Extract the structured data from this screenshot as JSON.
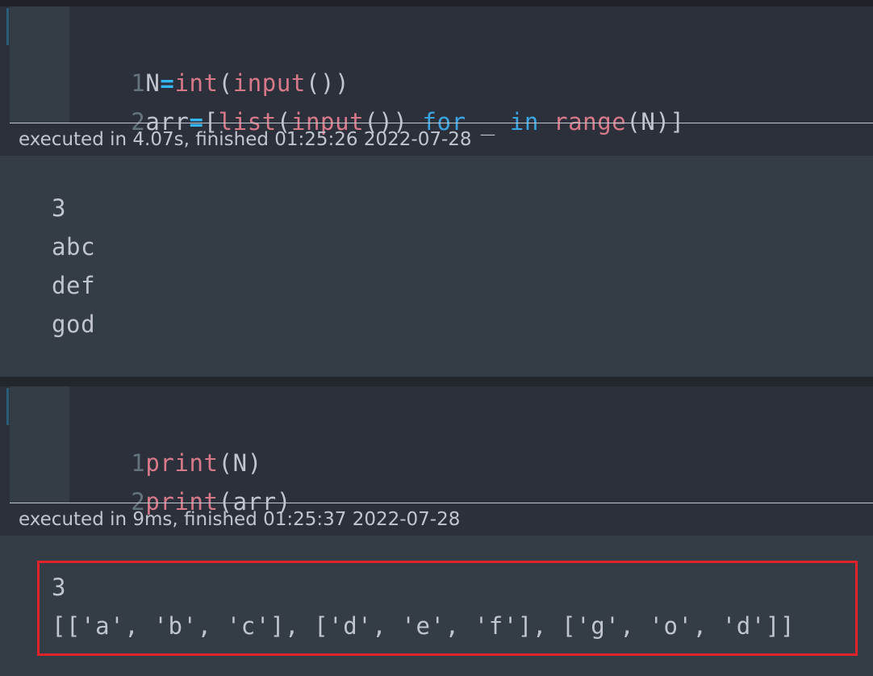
{
  "cells": [
    {
      "code_lines": [
        {
          "number": "1",
          "tokens": [
            {
              "text": "N",
              "kind": "pn"
            },
            {
              "text": "=",
              "kind": "op"
            },
            {
              "text": "int",
              "kind": "fn"
            },
            {
              "text": "(",
              "kind": "pn"
            },
            {
              "text": "input",
              "kind": "fn"
            },
            {
              "text": "())",
              "kind": "pn"
            }
          ]
        },
        {
          "number": "2",
          "tokens": [
            {
              "text": "arr",
              "kind": "pn"
            },
            {
              "text": "=",
              "kind": "op"
            },
            {
              "text": "[",
              "kind": "pn"
            },
            {
              "text": "list",
              "kind": "fn"
            },
            {
              "text": "(",
              "kind": "pn"
            },
            {
              "text": "input",
              "kind": "fn"
            },
            {
              "text": "()) ",
              "kind": "pn"
            },
            {
              "text": "for",
              "kind": "kw"
            },
            {
              "text": " _ ",
              "kind": "pn"
            },
            {
              "text": "in",
              "kind": "kw"
            },
            {
              "text": " ",
              "kind": "pn"
            },
            {
              "text": "range",
              "kind": "fn"
            },
            {
              "text": "(N)]",
              "kind": "pn"
            }
          ]
        }
      ],
      "exec_info": "executed in 4.07s, finished 01:25:26 2022-07-28",
      "output_lines": [
        "3",
        "abc",
        "def",
        "god"
      ]
    },
    {
      "code_lines": [
        {
          "number": "1",
          "tokens": [
            {
              "text": "print",
              "kind": "fn"
            },
            {
              "text": "(N)",
              "kind": "pn"
            }
          ]
        },
        {
          "number": "2",
          "tokens": [
            {
              "text": "print",
              "kind": "fn"
            },
            {
              "text": "(arr)",
              "kind": "pn"
            }
          ]
        }
      ],
      "exec_info": "executed in 9ms, finished 01:25:37 2022-07-28",
      "output_lines": [
        "3",
        "[['a', 'b', 'c'], ['d', 'e', 'f'], ['g', 'o', 'd']]"
      ]
    }
  ],
  "colors": {
    "background": "#2b303b",
    "gutter": "#343d46",
    "function": "#d8798a",
    "keyword": "#3aa5e0",
    "operator": "#35b6ef",
    "text": "#c0c5ce",
    "line_number": "#65737e",
    "highlight_border": "#e0232b"
  }
}
